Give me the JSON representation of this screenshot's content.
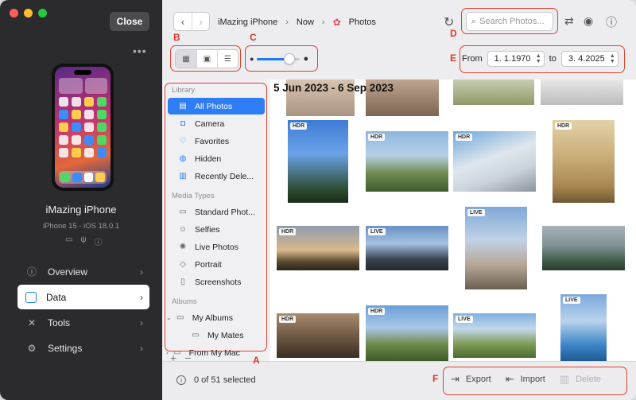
{
  "window": {
    "close_label": "Close",
    "more_label": "•••"
  },
  "device": {
    "name": "iMazing iPhone",
    "subtitle": "iPhone 15 - iOS 18.0.1",
    "icons": [
      "battery-icon",
      "usb-icon",
      "info-icon"
    ]
  },
  "nav": {
    "items": [
      {
        "label": "Overview",
        "icon": "info-circle-icon"
      },
      {
        "label": "Data",
        "icon": "square-icon",
        "active": true
      },
      {
        "label": "Tools",
        "icon": "tools-icon"
      },
      {
        "label": "Settings",
        "icon": "gear-icon"
      }
    ]
  },
  "toolbar": {
    "breadcrumb": [
      "iMazing iPhone",
      "Now",
      "Photos"
    ],
    "search_placeholder": "Search Photos...",
    "date_from_label": "From",
    "date_from": "1. 1.1970",
    "date_to_label": "to",
    "date_to": "3. 4.2025",
    "zoom_level": 0.75
  },
  "library": {
    "sections": [
      {
        "title": "Library",
        "items": [
          "All Photos",
          "Camera",
          "Favorites",
          "Hidden",
          "Recently Dele..."
        ]
      },
      {
        "title": "Media Types",
        "items": [
          "Standard Phot...",
          "Selfies",
          "Live Photos",
          "Portrait",
          "Screenshots"
        ]
      },
      {
        "title": "Albums",
        "items": [
          "My Albums",
          "My Mates",
          "From My Mac"
        ]
      }
    ]
  },
  "photos": {
    "date_range_heading": "5 Jun 2023 - 6 Sep 2023",
    "badges": [
      "HDR",
      "HDR",
      "HDR",
      "HDR",
      "LIVE",
      "LIVE",
      "HDR",
      "HDR",
      "HDR",
      "LIVE"
    ]
  },
  "bottom": {
    "add_label": "+",
    "remove_label": "−",
    "status": "0 of 51 selected",
    "export_label": "Export",
    "import_label": "Import",
    "delete_label": "Delete"
  },
  "annotations": {
    "letters": [
      "A",
      "B",
      "C",
      "D",
      "E",
      "F"
    ],
    "color": "#e0402f"
  },
  "colors": {
    "accent": "#2f7df4",
    "sidebar_dark": "#2b2b2e"
  }
}
